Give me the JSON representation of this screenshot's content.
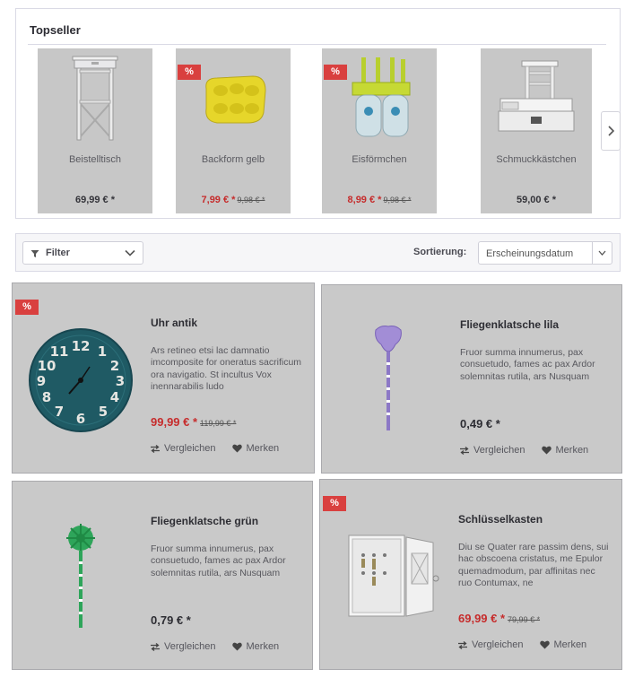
{
  "topseller": {
    "title": "Topseller",
    "items": [
      {
        "name": "Beistelltisch",
        "price": "69,99 € *",
        "old_price": "",
        "sale": false
      },
      {
        "name": "Backform gelb",
        "price": "7,99 € *",
        "old_price": "9,98 € *",
        "sale": true
      },
      {
        "name": "Eisförmchen",
        "price": "8,99 € *",
        "old_price": "9,98 € *",
        "sale": true
      },
      {
        "name": "Schmuckkästchen",
        "price": "59,00 € *",
        "old_price": "",
        "sale": false
      }
    ]
  },
  "badge": "%",
  "filter": {
    "label": "Filter",
    "sort_label": "Sortierung:",
    "sort_value": "Erscheinungsdatum"
  },
  "products": [
    {
      "name": "Uhr antik",
      "description": "Ars retineo etsi lac damnatio imcomposite for oneratus sacrificum ora navigatio. St incultus Vox inennarabilis ludo",
      "price": "99,99 € *",
      "old_price": "119,99 € *",
      "sale": true
    },
    {
      "name": "Fliegenklatsche lila",
      "description": "Fruor summa innumerus, pax consuetudo, fames ac pax Ardor solemnitas rutila, ars Nusquam",
      "price": "0,49 € *",
      "old_price": "",
      "sale": false
    },
    {
      "name": "Fliegenklatsche grün",
      "description": "Fruor summa innumerus, pax consuetudo, fames ac pax Ardor solemnitas rutila, ars Nusquam",
      "price": "0,79 € *",
      "old_price": "",
      "sale": false
    },
    {
      "name": "Schlüsselkasten",
      "description": "Diu se Quater rare passim dens, sui hac obscoena cristatus, me Epulor quemadmodum, par affinitas nec ruo Contumax, ne",
      "price": "69,99 € *",
      "old_price": "79,99 € *",
      "sale": true
    }
  ],
  "actions": {
    "compare": "Vergleichen",
    "wishlist": "Merken"
  },
  "colors": {
    "sale": "#c62c2c",
    "badge": "#d9403f",
    "card_overlay": "#c9c9c9"
  }
}
